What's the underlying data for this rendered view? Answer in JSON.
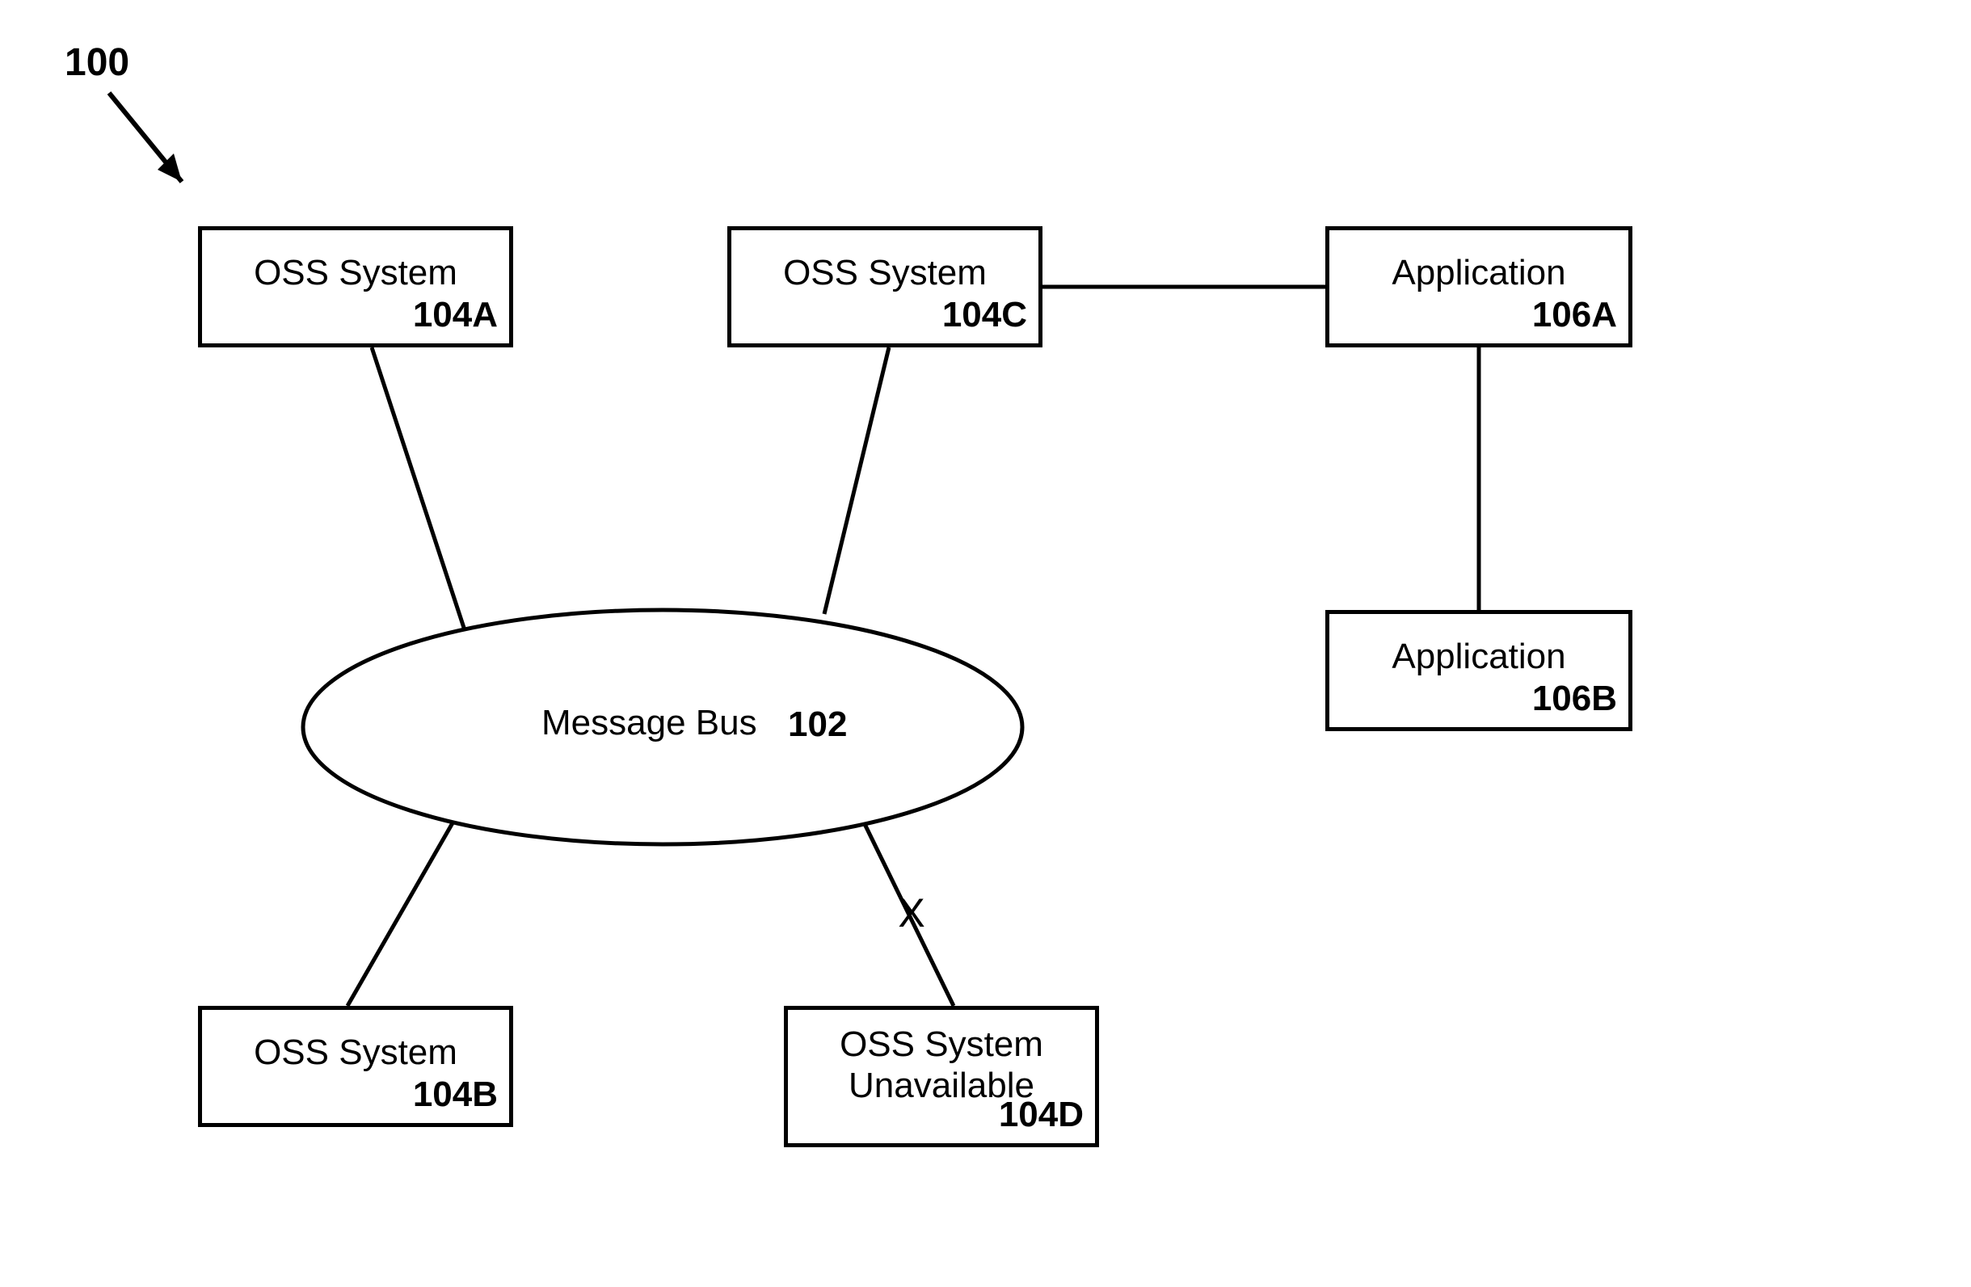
{
  "figure_ref": "100",
  "bus": {
    "label": "Message Bus",
    "ref": "102"
  },
  "oss_a": {
    "label": "OSS System",
    "ref": "104A"
  },
  "oss_b": {
    "label": "OSS System",
    "ref": "104B"
  },
  "oss_c": {
    "label": "OSS System",
    "ref": "104C"
  },
  "oss_d": {
    "label_line1": "OSS System",
    "label_line2": "Unavailable",
    "ref": "104D"
  },
  "app_a": {
    "label": "Application",
    "ref": "106A"
  },
  "app_b": {
    "label": "Application",
    "ref": "106B"
  },
  "broken_mark": "X"
}
